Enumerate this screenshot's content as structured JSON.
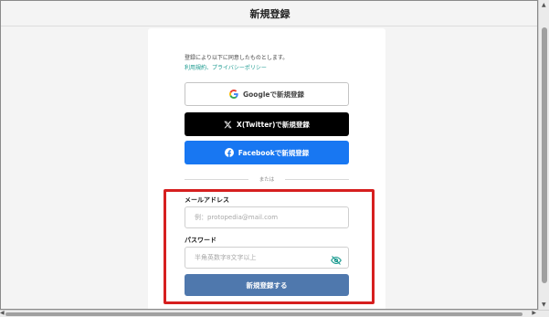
{
  "page": {
    "title": "新規登録"
  },
  "terms": {
    "text": "登録により以下に同意したものとします。",
    "link_terms": "利用規約",
    "separator": "、",
    "link_privacy": "プライバシーポリシー"
  },
  "social": {
    "google_label": "Googleで新規登録",
    "x_label": "X(Twitter)で新規登録",
    "facebook_label": "Facebookで新規登録"
  },
  "divider": {
    "text": "または"
  },
  "form": {
    "email_label": "メールアドレス",
    "email_placeholder": "例：protopedia@mail.com",
    "password_label": "パスワード",
    "password_placeholder": "半角英数字8文字以上",
    "submit_label": "新規登録する"
  },
  "icons": {
    "google": "google-icon",
    "x": "x-logo-icon",
    "facebook": "facebook-icon",
    "password_toggle": "eye-slash-icon"
  },
  "colors": {
    "facebook": "#1877f2",
    "x": "#000000",
    "submit": "#4f78ad",
    "link": "#1a9a8f",
    "highlight": "#d61f1f"
  }
}
